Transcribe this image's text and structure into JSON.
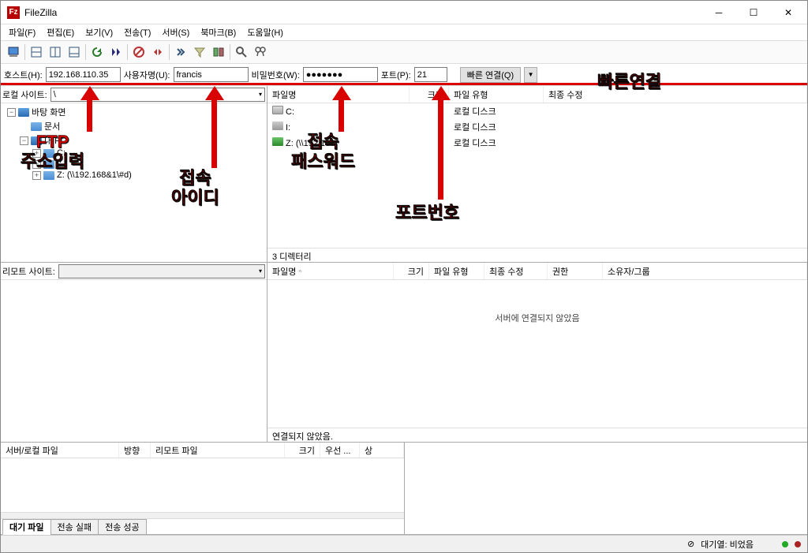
{
  "title": "FileZilla",
  "menu": {
    "file": "파일(F)",
    "edit": "편집(E)",
    "view": "보기(V)",
    "transfer": "전송(T)",
    "server": "서버(S)",
    "bookmarks": "북마크(B)",
    "help": "도움말(H)"
  },
  "quickconnect": {
    "host_label": "호스트(H):",
    "host_value": "192.168.110.35",
    "user_label": "사용자명(U):",
    "user_value": "francis",
    "pass_label": "비밀번호(W):",
    "pass_value": "●●●●●●●",
    "port_label": "포트(P):",
    "port_value": "21",
    "connect_btn": "빠른 연결(Q)"
  },
  "local": {
    "site_label": "로컬 사이트:",
    "site_value": "\\",
    "tree": {
      "desktop": "바탕 화면",
      "documents": "문서",
      "mypc": "내 PC",
      "c": "C:",
      "i": "I:",
      "z": "Z: (\\\\192.168&1\\#d)"
    }
  },
  "file_list": {
    "headers": {
      "name": "파일명",
      "size": "크기",
      "type": "파일 유형",
      "modified": "최종 수정"
    },
    "rows": [
      {
        "name": "C:",
        "type": "로컬 디스크"
      },
      {
        "name": "I:",
        "type": "로컬 디스크"
      },
      {
        "name": "Z: (\\\\192.168",
        "type": "로컬 디스크"
      }
    ],
    "status": "3 디렉터리"
  },
  "remote": {
    "site_label": "리모트 사이트:",
    "headers": {
      "name": "파일명",
      "size": "크기",
      "type": "파일 유형",
      "modified": "최종 수정",
      "perm": "권한",
      "owner": "소유자/그룹"
    },
    "not_connected": "서버에 연결되지 않았음",
    "status": "연결되지 않았음."
  },
  "queue": {
    "headers": {
      "file": "서버/로컬 파일",
      "dir": "방향",
      "remote": "리모트 파일",
      "size": "크기",
      "prio": "우선 ...",
      "stat": "상"
    },
    "tabs": {
      "queued": "대기 파일",
      "failed": "전송 실패",
      "success": "전송 성공"
    }
  },
  "statusbar": {
    "queue": "대기열: 비었음"
  },
  "annotations": {
    "host": "FTP\n주소입력",
    "user": "접속\n아이디",
    "pass": "접속\n패스워드",
    "port": "포트번호",
    "connect": "빠른연결"
  }
}
